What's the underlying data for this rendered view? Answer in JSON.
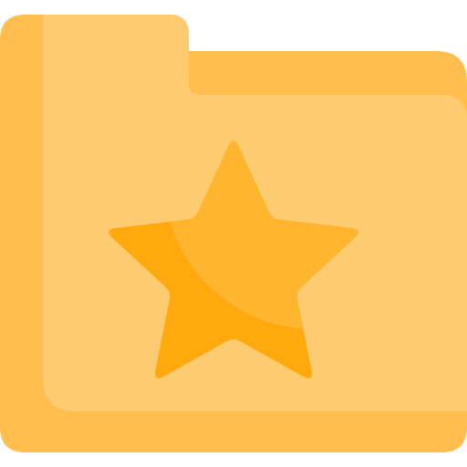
{
  "icon": {
    "name": "favorite-folder-icon",
    "colors": {
      "folder_back": "#FFBE4D",
      "folder_front": "#FFCB70",
      "star_light": "#FFB52E",
      "star_dark": "#FFA90F",
      "background": "#FFFFFF"
    }
  }
}
